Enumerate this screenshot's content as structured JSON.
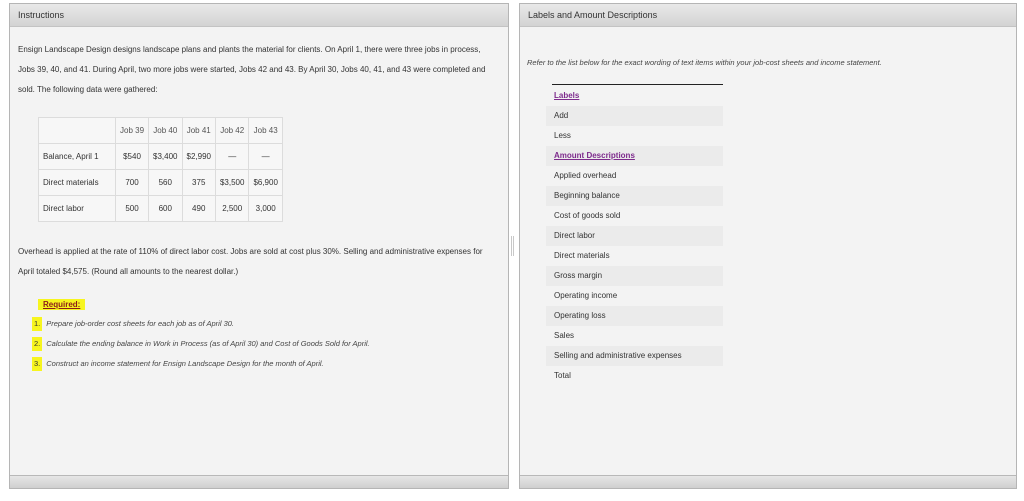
{
  "left_panel": {
    "title": "Instructions",
    "intro": "Ensign Landscape Design designs landscape plans and plants the material for clients. On April 1, there were three jobs in process, Jobs 39, 40, and 41. During April, two more jobs were started, Jobs 42 and 43. By April 30, Jobs 40, 41, and 43 were completed and sold. The following data were gathered:",
    "table": {
      "headers": [
        "",
        "Job 39",
        "Job 40",
        "Job 41",
        "Job 42",
        "Job 43"
      ],
      "rows": [
        {
          "label": "Balance, April 1",
          "values": [
            "$540",
            "$3,400",
            "$2,990",
            "—",
            "—"
          ]
        },
        {
          "label": "Direct materials",
          "values": [
            "700",
            "560",
            "375",
            "$3,500",
            "$6,900"
          ]
        },
        {
          "label": "Direct labor",
          "values": [
            "500",
            "600",
            "490",
            "2,500",
            "3,000"
          ]
        }
      ]
    },
    "overhead_text": "Overhead is applied at the rate of 110% of direct labor cost. Jobs are sold at cost plus 30%. Selling and administrative expenses for April totaled $4,575. (Round all amounts to the nearest dollar.)",
    "required_label": "Required:",
    "requirements": [
      {
        "num": "1.",
        "text": "Prepare job-order cost sheets for each job as of April 30."
      },
      {
        "num": "2.",
        "text": "Calculate the ending balance in Work in Process (as of April 30) and Cost of Goods Sold for April."
      },
      {
        "num": "3.",
        "text": "Construct an income statement for Ensign Landscape Design for the month of April."
      }
    ]
  },
  "right_panel": {
    "title": "Labels and Amount Descriptions",
    "refer_text": "Refer to the list below for the exact wording of text items within your job-cost sheets and income statement.",
    "labels_heading": "Labels",
    "labels": [
      "Add",
      "Less"
    ],
    "amounts_heading": "Amount Descriptions",
    "amounts": [
      "Applied overhead",
      "Beginning balance",
      "Cost of goods sold",
      "Direct labor",
      "Direct materials",
      "Gross margin",
      "Operating income",
      "Operating loss",
      "Sales",
      "Selling and administrative expenses",
      "Total"
    ]
  }
}
